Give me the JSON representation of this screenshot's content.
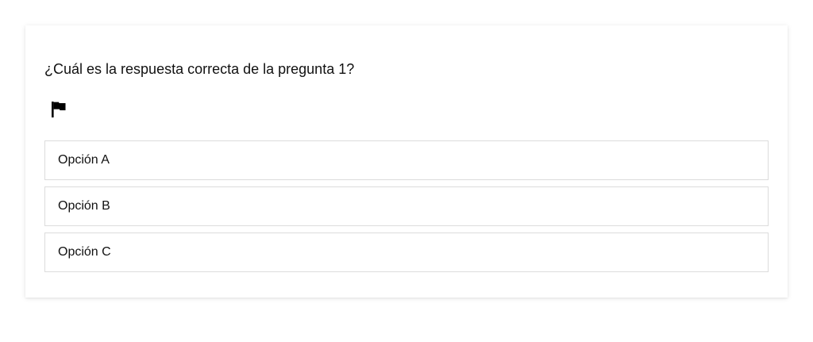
{
  "question": {
    "text": "¿Cuál es la respuesta correcta de la pregunta 1?"
  },
  "flag": {
    "icon": "flag-icon"
  },
  "options": [
    {
      "label": "Opción A"
    },
    {
      "label": "Opción B"
    },
    {
      "label": "Opción C"
    }
  ],
  "colors": {
    "border": "#dcdcdc",
    "text": "#111111",
    "background": "#ffffff"
  }
}
